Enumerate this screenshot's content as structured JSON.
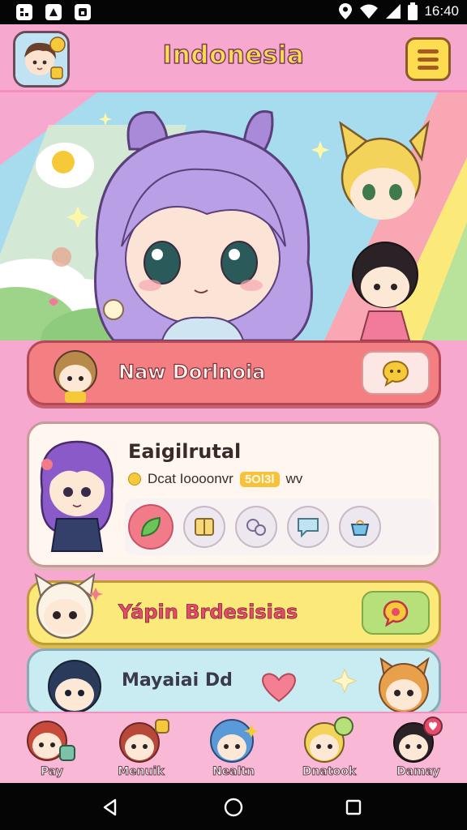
{
  "status_bar": {
    "time": "16:40",
    "icons": [
      "app-icon",
      "app-icon",
      "app-icon",
      "location-icon",
      "wifi-icon",
      "signal-icon",
      "battery-icon"
    ]
  },
  "header": {
    "title": "Indonesia",
    "menu_icon": "hamburger-menu-icon"
  },
  "cards": {
    "new": {
      "title": "Naw Dorlnoia",
      "icon": "chat-bubble-icon"
    },
    "profile": {
      "title": "Eaigilrutal",
      "sub_text": "Dcat Ioooonvr",
      "sub_badge": "5Ol3l",
      "sub_extra": "wv",
      "slots": [
        "leaf-icon",
        "book-icon",
        "bubbles-icon",
        "speech-bubble-icon",
        "basket-icon"
      ]
    },
    "yapin": {
      "title": "Yápin Brdesisias",
      "icon": "chat-bubble-icon"
    },
    "mayaiai": {
      "title": "Mayaiai Dd"
    }
  },
  "bottom_nav": [
    {
      "label": "Pay"
    },
    {
      "label": "Menuik"
    },
    {
      "label": "Nealtn"
    },
    {
      "label": "Dnatook"
    },
    {
      "label": "Damay"
    }
  ],
  "colors": {
    "background": "#f7a8cf",
    "title_yellow": "#fbdb55",
    "card_red": "#f47f82",
    "card_yellow": "#fbe97a",
    "card_blue": "#c9ecf3"
  }
}
